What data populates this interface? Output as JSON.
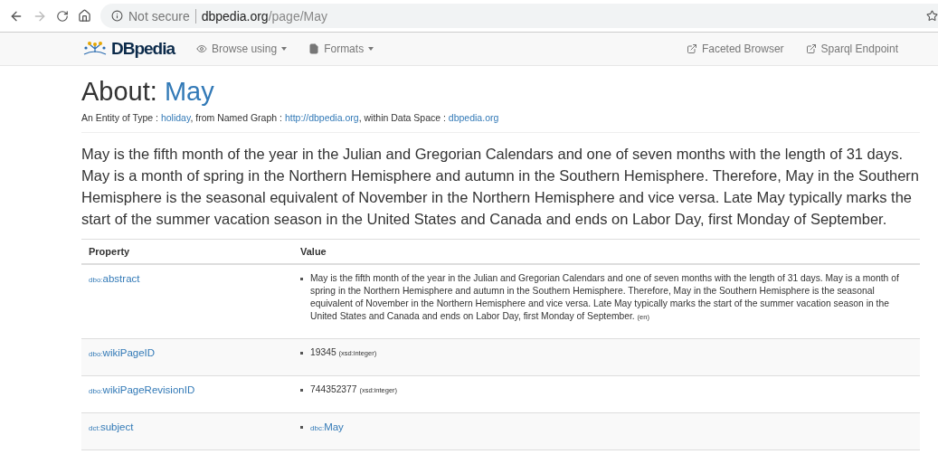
{
  "browser": {
    "security": "Not secure",
    "domain": "dbpedia.org",
    "path": "/page/May"
  },
  "navbar": {
    "logo": "DBpedia",
    "menus": [
      {
        "label": "Browse using",
        "kind": "eye"
      },
      {
        "label": "Formats",
        "kind": "file"
      }
    ],
    "links": [
      "Faceted Browser",
      "Sparql Endpoint"
    ]
  },
  "title": {
    "prefix": "About: ",
    "entity": "May"
  },
  "subtitle": [
    {
      "kind": "text",
      "text": "An Entity of Type : "
    },
    {
      "kind": "link",
      "text": "holiday"
    },
    {
      "kind": "text",
      "text": ", from Named Graph : "
    },
    {
      "kind": "link",
      "text": "http://dbpedia.org"
    },
    {
      "kind": "text",
      "text": ", within Data Space : "
    },
    {
      "kind": "link",
      "text": "dbpedia.org"
    }
  ],
  "lead": "May is the fifth month of the year in the Julian and Gregorian Calendars and one of seven months with the length of 31 days. May is a month of spring in the Northern Hemisphere and autumn in the Southern Hemisphere. Therefore, May in the Southern Hemisphere is the seasonal equivalent of November in the Northern Hemisphere and vice versa. Late May typically marks the start of the summer vacation season in the United States and Canada and ends on Labor Day, first Monday of September.",
  "table": {
    "columns": [
      "Property",
      "Value"
    ],
    "rows": [
      {
        "prefix": "dbo:",
        "name": "abstract",
        "value": {
          "kind": "literal",
          "text": "May is the fifth month of the year in the Julian and Gregorian Calendars and one of seven months with the length of 31 days. May is a month of spring in the Northern Hemisphere and autumn in the Southern Hemisphere. Therefore, May in the Southern Hemisphere is the seasonal equivalent of November in the Northern Hemisphere and vice versa. Late May typically marks the start of the summer vacation season in the United States and Canada and ends on Labor Day, first Monday of September.",
          "suffix": "(en)"
        }
      },
      {
        "prefix": "dbo:",
        "name": "wikiPageID",
        "value": {
          "kind": "literal",
          "text": "19345",
          "suffix": "(xsd:integer)"
        }
      },
      {
        "prefix": "dbo:",
        "name": "wikiPageRevisionID",
        "value": {
          "kind": "literal",
          "text": "744352377",
          "suffix": "(xsd:integer)"
        }
      },
      {
        "prefix": "dct:",
        "name": "subject",
        "value": {
          "kind": "link",
          "prefix": "dbc:",
          "text": "May"
        }
      }
    ]
  }
}
